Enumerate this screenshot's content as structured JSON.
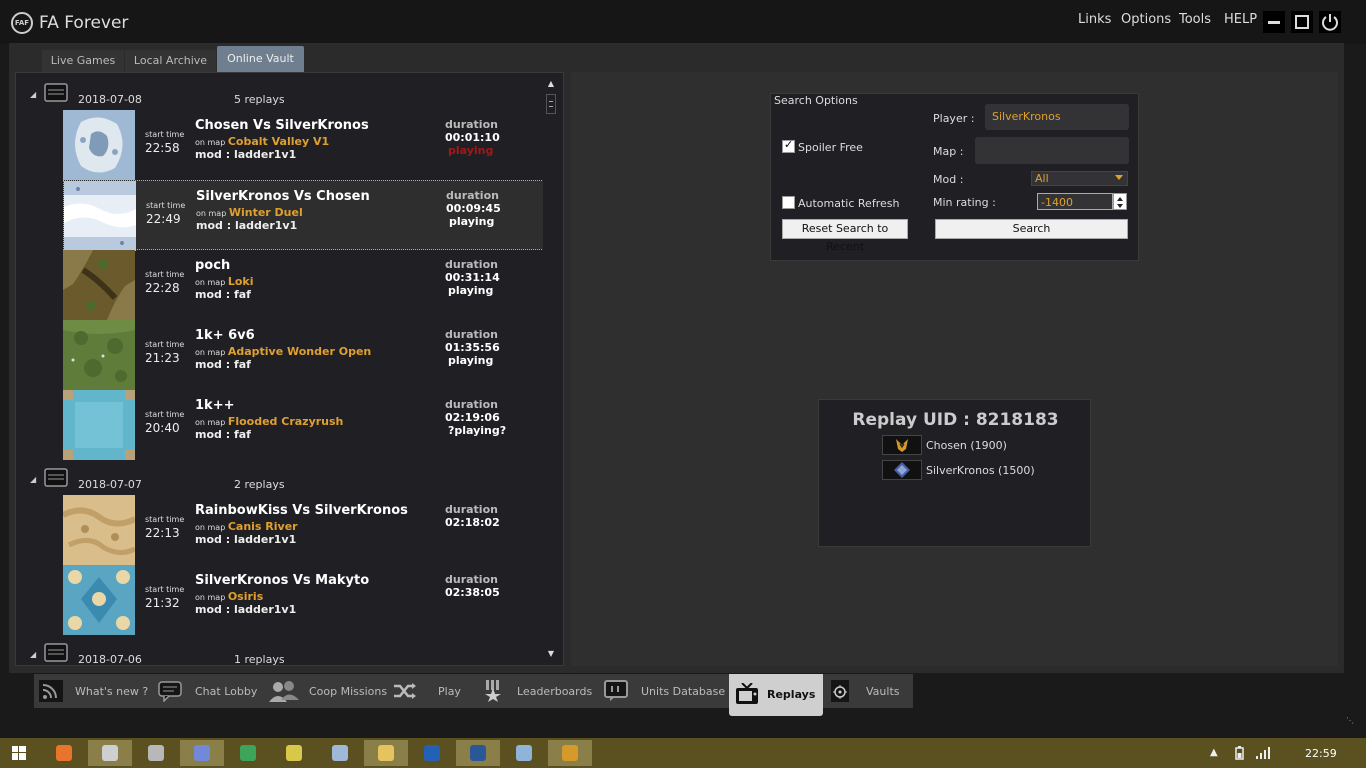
{
  "app": {
    "title": "FA Forever",
    "logo_text": "FAF",
    "menu": [
      "Links",
      "Options",
      "Tools",
      "HELP"
    ]
  },
  "subtabs": [
    "Live Games",
    "Local Archive",
    "Online Vault"
  ],
  "days": [
    {
      "date": "2018-07-08",
      "count": "5 replays",
      "replays": [
        {
          "title": "Chosen Vs SilverKronos",
          "start_label": "start time",
          "time": "22:58",
          "on_map": "on map",
          "map": "Cobalt Valley V1",
          "mod": "mod : ladder1v1",
          "dur_label": "duration",
          "duration": "00:01:10",
          "status": "playing",
          "status_color": "#a01818",
          "thumb": "cobalt"
        },
        {
          "title": "SilverKronos Vs Chosen",
          "start_label": "start time",
          "time": "22:49",
          "on_map": "on map",
          "map": "Winter Duel",
          "mod": "mod : ladder1v1",
          "dur_label": "duration",
          "duration": "00:09:45",
          "status": "playing",
          "status_color": "#ffffff",
          "thumb": "winter"
        },
        {
          "title": "poch",
          "start_label": "start time",
          "time": "22:28",
          "on_map": "on map",
          "map": "Loki",
          "mod": "mod : faf",
          "dur_label": "duration",
          "duration": "00:31:14",
          "status": "playing",
          "status_color": "#ffffff",
          "thumb": "loki"
        },
        {
          "title": "1k+ 6v6",
          "start_label": "start time",
          "time": "21:23",
          "on_map": "on map",
          "map": "Adaptive Wonder Open",
          "mod": "mod : faf",
          "dur_label": "duration",
          "duration": "01:35:56",
          "status": "playing",
          "status_color": "#ffffff",
          "thumb": "wonder"
        },
        {
          "title": "1k++",
          "start_label": "start time",
          "time": "20:40",
          "on_map": "on map",
          "map": "Flooded Crazyrush",
          "mod": "mod : faf",
          "dur_label": "duration",
          "duration": "02:19:06",
          "status": "?playing?",
          "status_color": "#ffffff",
          "thumb": "flooded"
        }
      ]
    },
    {
      "date": "2018-07-07",
      "count": "2 replays",
      "replays": [
        {
          "title": "RainbowKiss Vs SilverKronos",
          "start_label": "start time",
          "time": "22:13",
          "on_map": "on map",
          "map": "Canis River",
          "mod": "mod : ladder1v1",
          "dur_label": "duration",
          "duration": "02:18:02",
          "status": "",
          "status_color": "#ffffff",
          "thumb": "canis"
        },
        {
          "title": "SilverKronos Vs Makyto",
          "start_label": "start time",
          "time": "21:32",
          "on_map": "on map",
          "map": "Osiris",
          "mod": "mod : ladder1v1",
          "dur_label": "duration",
          "duration": "02:38:05",
          "status": "",
          "status_color": "#ffffff",
          "thumb": "osiris"
        }
      ]
    },
    {
      "date": "2018-07-06",
      "count": "1 replays",
      "replays": []
    }
  ],
  "search": {
    "title": "Search Options",
    "player_label": "Player :",
    "player_value": "SilverKronos",
    "spoiler_label": "Spoiler Free",
    "spoiler_checked": true,
    "map_label": "Map :",
    "map_value": "",
    "mod_label": "Mod :",
    "mod_value": "All",
    "auto_refresh_label": "Automatic Refresh",
    "auto_refresh_checked": false,
    "min_rating_label": "Min rating :",
    "min_rating_value": "-1400",
    "reset_button": "Reset Search to Recent",
    "search_button": "Search"
  },
  "details": {
    "uid_title": "Replay UID : 8218183",
    "players": [
      {
        "name": "Chosen (1900)",
        "faction_icon": "cybran-icon"
      },
      {
        "name": "SilverKronos (1500)",
        "faction_icon": "aeon-icon"
      }
    ]
  },
  "bottom_nav": [
    {
      "label": "What's new ?",
      "icon": "rss-icon"
    },
    {
      "label": "Chat Lobby",
      "icon": "chat-icon"
    },
    {
      "label": "Coop Missions",
      "icon": "users-icon"
    },
    {
      "label": "Play",
      "icon": "shuffle-icon"
    },
    {
      "label": "Leaderboards",
      "icon": "leaderboard-icon"
    },
    {
      "label": "Units Database",
      "icon": "units-icon"
    },
    {
      "label": "Replays",
      "icon": "tv-icon",
      "active": true
    },
    {
      "label": "Vaults",
      "icon": "vault-icon"
    }
  ],
  "taskbar": {
    "apps": [
      "firefox",
      "faf",
      "archive",
      "discord",
      "chrome",
      "paint",
      "notepad",
      "explorer",
      "uplay",
      "word",
      "calculator",
      "faf-client"
    ],
    "clock": "22:59"
  },
  "colors": {
    "accent_orange": "#e0a030",
    "playing_red": "#a01818",
    "active_tab": "#6f7f8f"
  }
}
